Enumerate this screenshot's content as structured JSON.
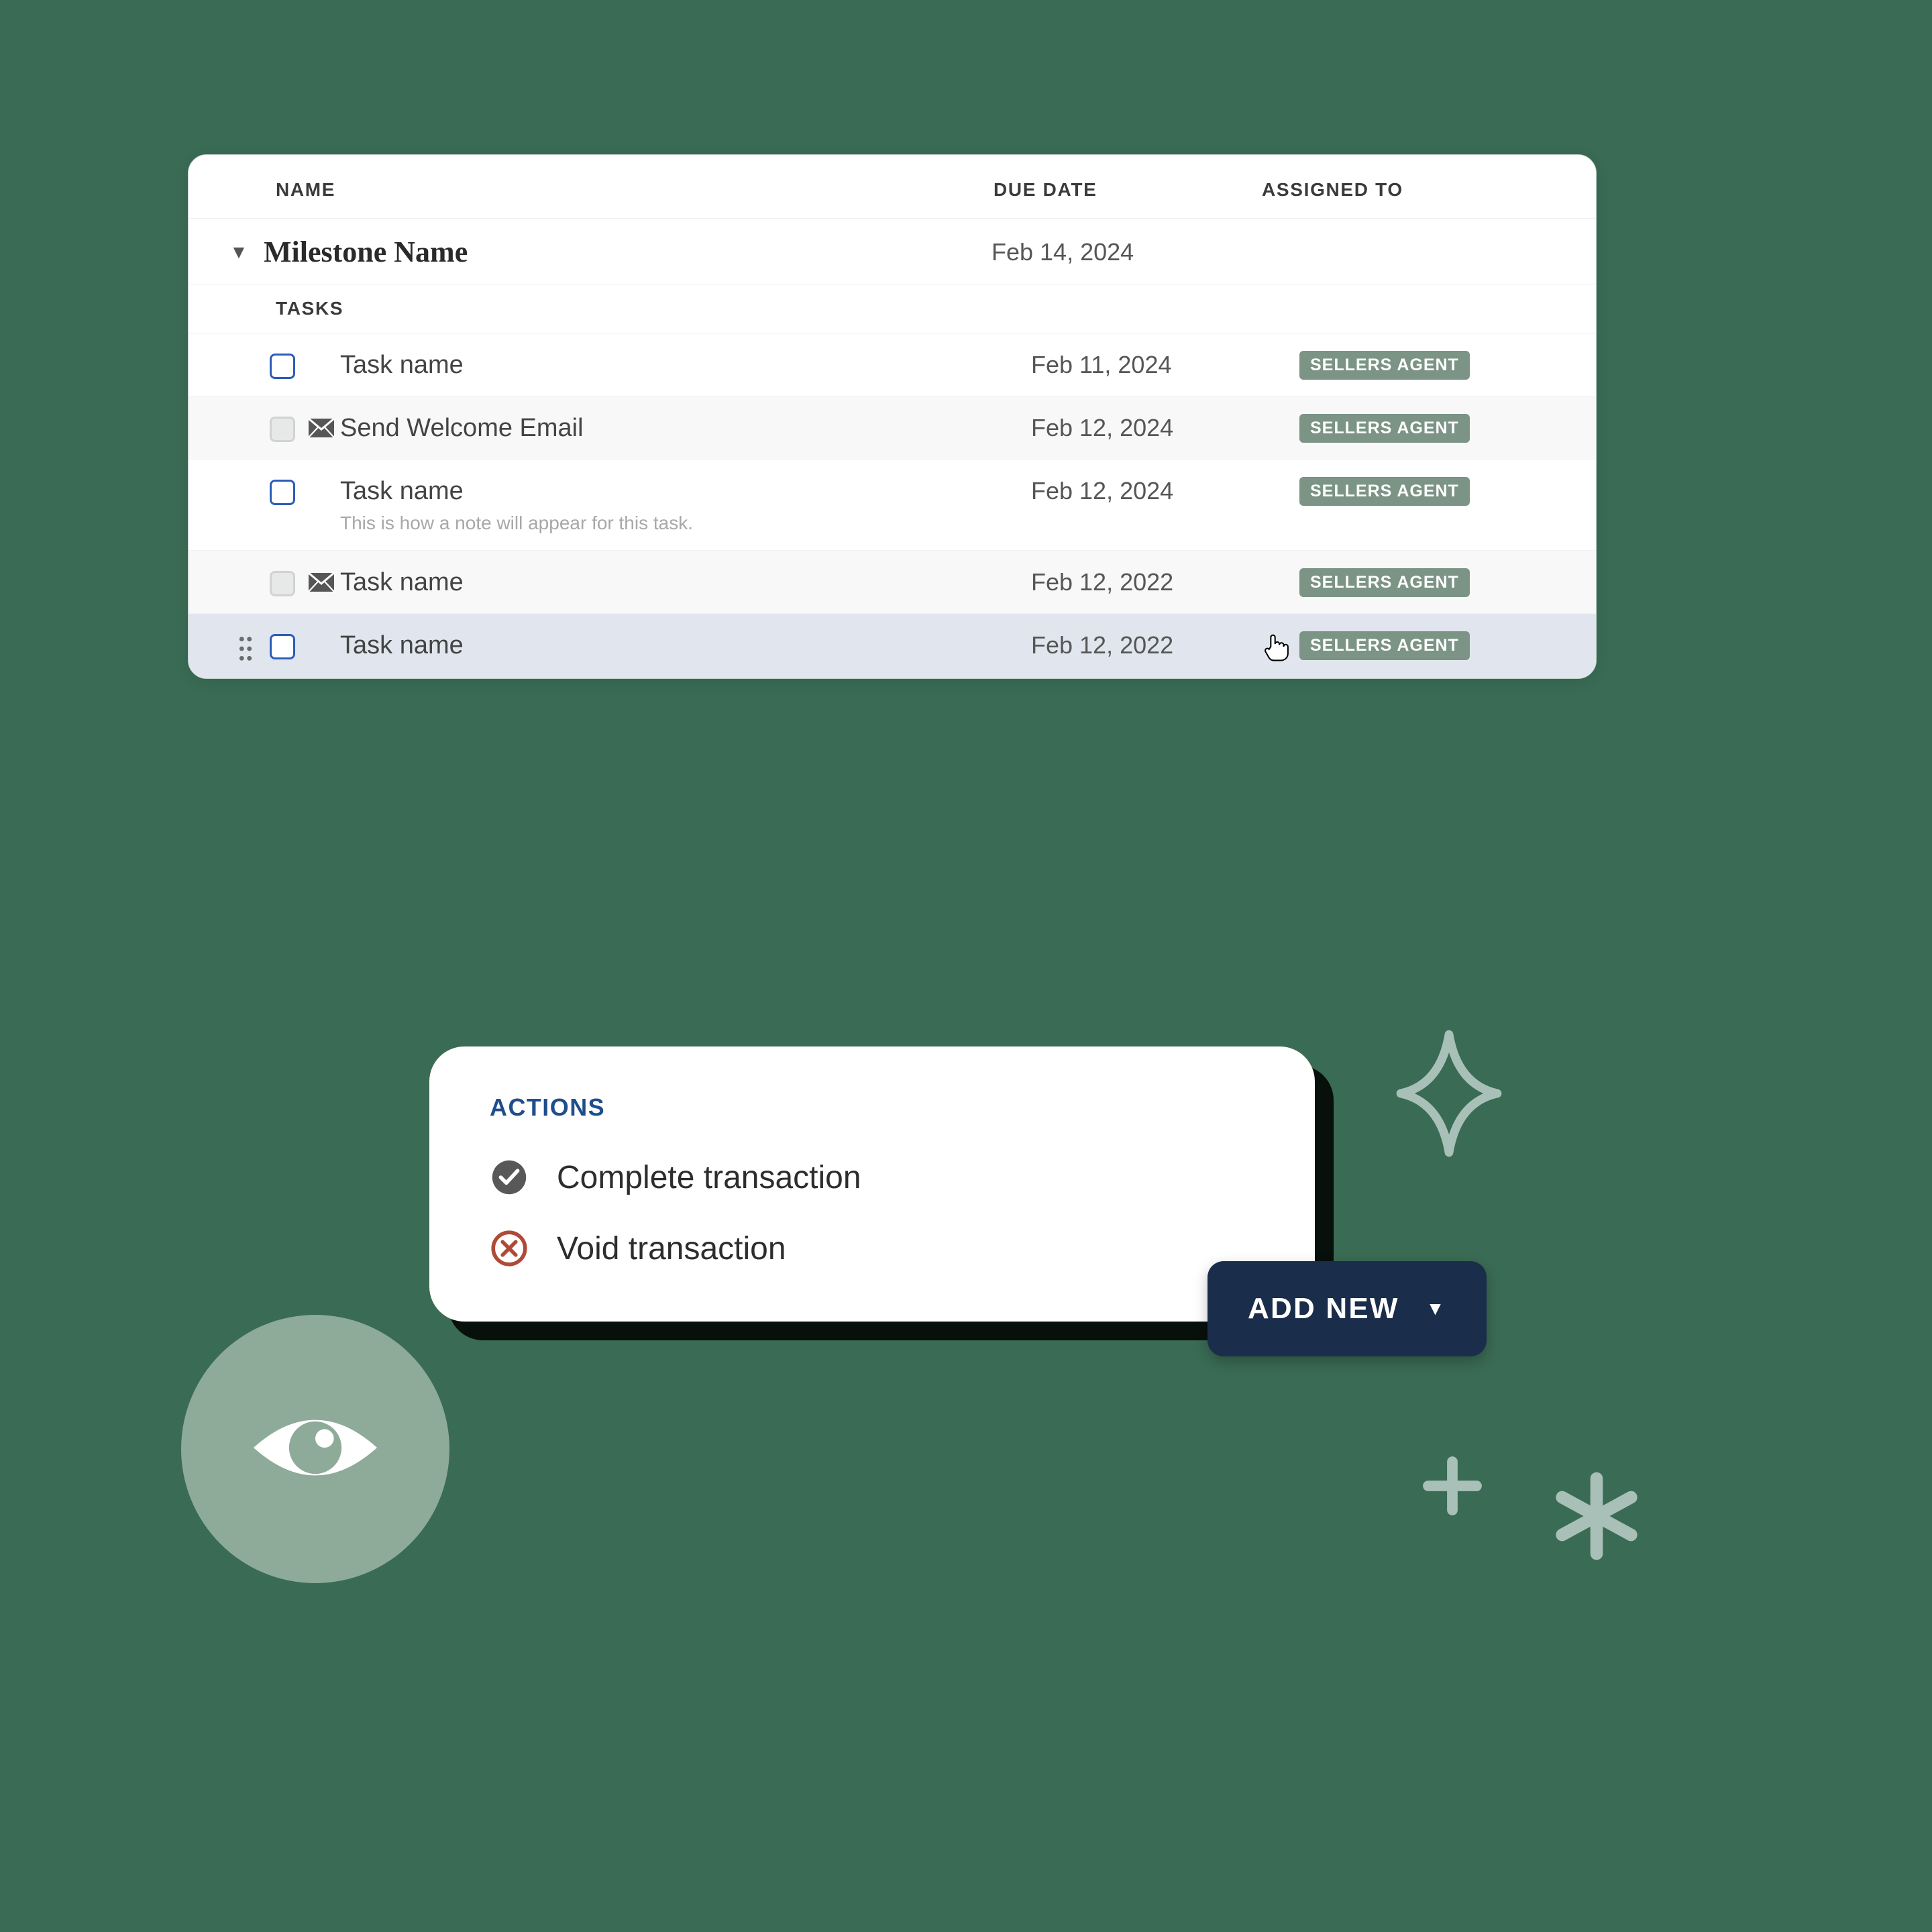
{
  "table": {
    "headers": {
      "name": "NAME",
      "due": "DUE DATE",
      "assigned": "ASSIGNED TO"
    },
    "milestone": {
      "name": "Milestone Name",
      "due": "Feb 14, 2024"
    },
    "tasks_label": "TASKS",
    "tasks": [
      {
        "name": "Task name",
        "due": "Feb 11, 2024",
        "assignee": "SELLERS AGENT",
        "checkbox": "enabled",
        "icon": null,
        "note": null,
        "alt": false,
        "hover": false,
        "drag": false
      },
      {
        "name": "Send Welcome Email",
        "due": "Feb 12, 2024",
        "assignee": "SELLERS AGENT",
        "checkbox": "disabled",
        "icon": "email",
        "note": null,
        "alt": true,
        "hover": false,
        "drag": false
      },
      {
        "name": "Task name",
        "due": "Feb 12, 2024",
        "assignee": "SELLERS AGENT",
        "checkbox": "enabled",
        "icon": null,
        "note": "This is how a note will appear for this task.",
        "alt": false,
        "hover": false,
        "drag": false
      },
      {
        "name": "Task name",
        "due": "Feb 12, 2022",
        "assignee": "SELLERS AGENT",
        "checkbox": "disabled",
        "icon": "email",
        "note": null,
        "alt": true,
        "hover": false,
        "drag": false
      },
      {
        "name": "Task name",
        "due": "Feb 12, 2022",
        "assignee": "SELLERS AGENT",
        "checkbox": "enabled",
        "icon": null,
        "note": null,
        "alt": false,
        "hover": true,
        "drag": true
      }
    ]
  },
  "actions": {
    "heading": "ACTIONS",
    "items": [
      {
        "label": "Complete transaction",
        "icon": "check-circle",
        "color": "#585858"
      },
      {
        "label": "Void transaction",
        "icon": "x-circle",
        "color": "#b04a37"
      }
    ]
  },
  "addnew": {
    "label": "ADD NEW"
  },
  "colors": {
    "background": "#3a6b54",
    "badge": "#7b9485",
    "addnew": "#1a2d4a",
    "eye": "#8eab99",
    "actions_heading": "#1f4e8c"
  }
}
